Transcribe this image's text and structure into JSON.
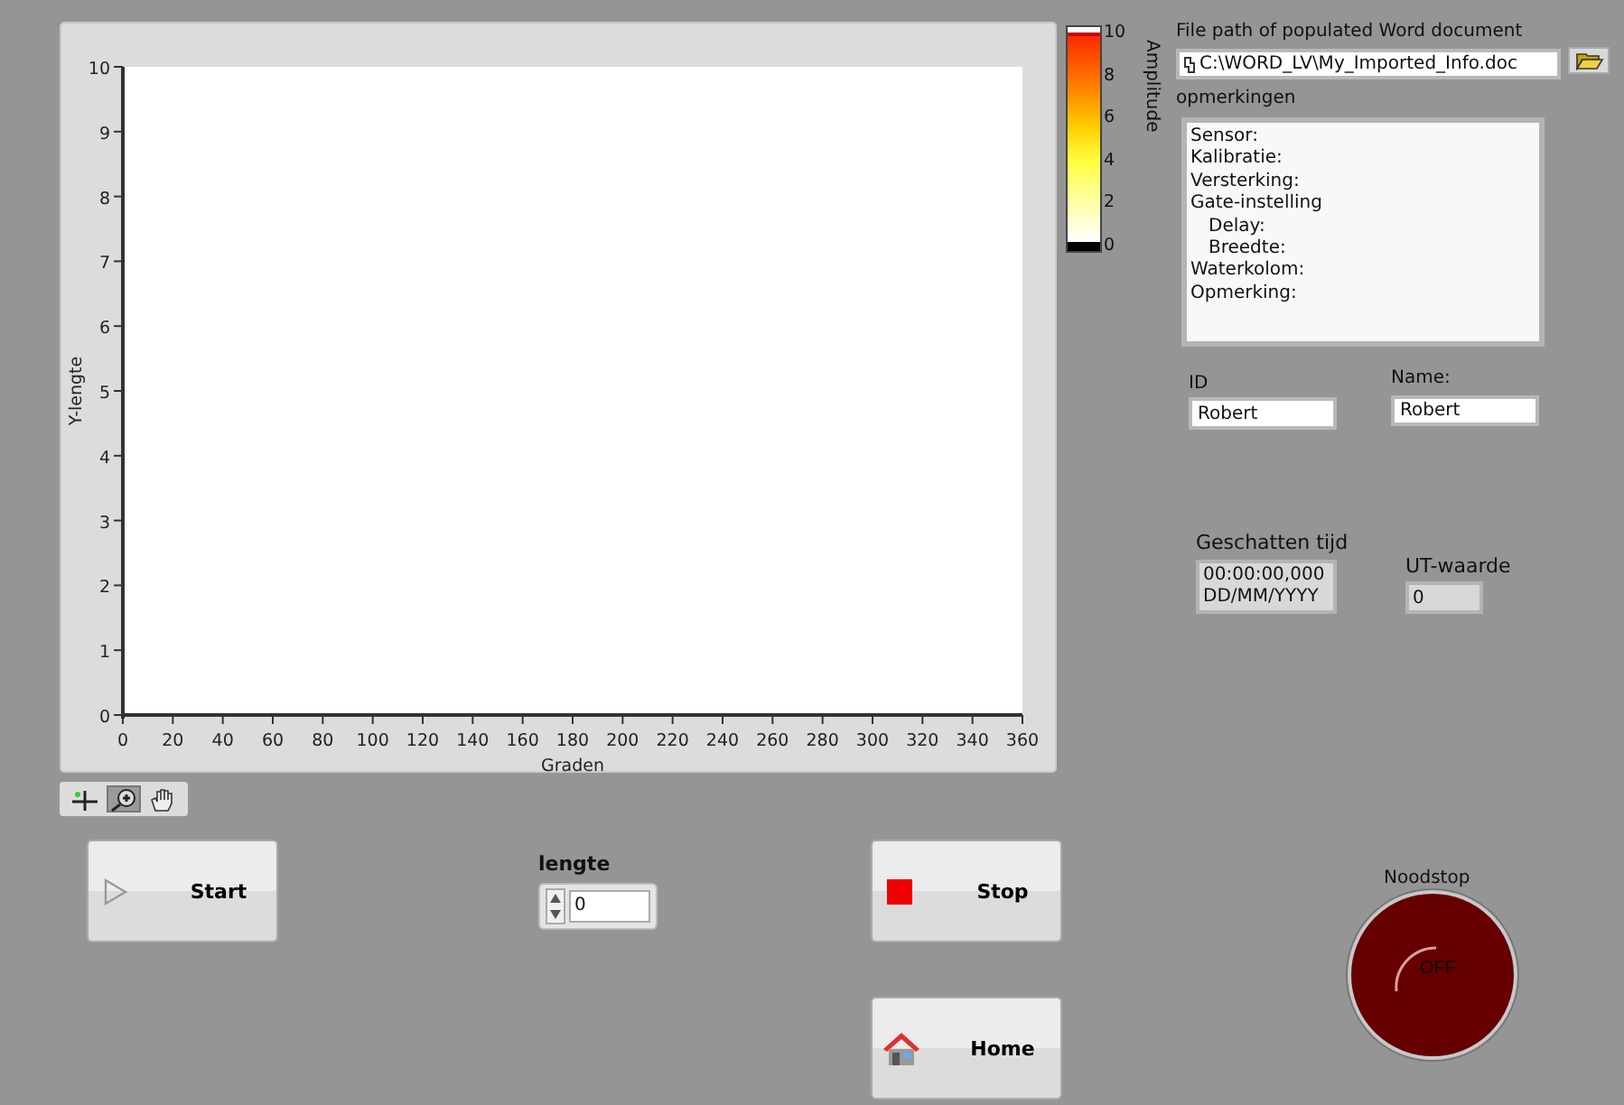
{
  "graph": {
    "chart_data": {
      "type": "scatter",
      "xlabel": "Graden",
      "ylabel": "Y-lengte",
      "xlim": [
        0,
        360
      ],
      "ylim": [
        0,
        10
      ],
      "xticks": [
        0,
        20,
        40,
        60,
        80,
        100,
        120,
        140,
        160,
        180,
        200,
        220,
        240,
        260,
        280,
        300,
        320,
        340,
        360
      ],
      "yticks": [
        0,
        1,
        2,
        3,
        4,
        5,
        6,
        7,
        8,
        9,
        10
      ]
    },
    "palette_tools": [
      {
        "kind": "cursor",
        "selected": false
      },
      {
        "kind": "zoom",
        "selected": true
      },
      {
        "kind": "pan",
        "selected": false
      }
    ]
  },
  "color_scale": {
    "label": "Amplitude",
    "ticks": [
      "10",
      "8",
      "6",
      "4",
      "2",
      "0"
    ]
  },
  "file_path": {
    "label": "File path of populated Word document",
    "value": "C:\\WORD_LV\\My_Imported_Info.doc"
  },
  "remarks": {
    "label": "opmerkingen",
    "lines": [
      {
        "text": "Sensor:"
      },
      {
        "text": "Kalibratie:"
      },
      {
        "text": "Versterking:"
      },
      {
        "text": "Gate-instelling",
        "children": [
          {
            "text": "Delay:"
          },
          {
            "text": "Breedte:"
          }
        ]
      },
      {
        "text": "Waterkolom:"
      },
      {
        "text": "Opmerking:"
      }
    ]
  },
  "id_field": {
    "label": "ID",
    "value": "Robert"
  },
  "name_field": {
    "label": "Name:",
    "value": "Robert"
  },
  "estimated_time": {
    "label": "Geschatten tijd",
    "lines": [
      "00:00:00,000",
      "DD/MM/YYYY"
    ]
  },
  "ut_value": {
    "label": "UT-waarde",
    "value": "0"
  },
  "buttons": [
    {
      "kind": "start",
      "label": "Start"
    },
    {
      "kind": "stop",
      "label": "Stop"
    },
    {
      "kind": "home",
      "label": "Home"
    }
  ],
  "length": {
    "label": "lengte",
    "value": "0"
  },
  "emergency_stop": {
    "label": "Noodstop",
    "text": "OFF",
    "on": false
  }
}
